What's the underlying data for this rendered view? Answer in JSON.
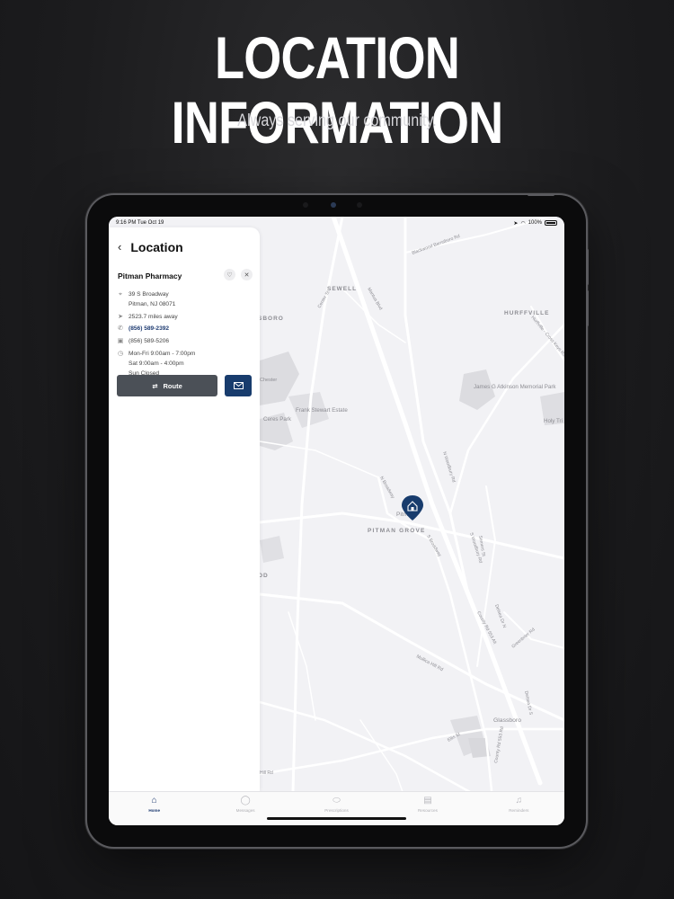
{
  "promo": {
    "headline": "LOCATION INFORMATION",
    "subheadline": "Always serving our community."
  },
  "status_bar": {
    "time": "9:16 PM  Tue Oct 19",
    "battery": "100%"
  },
  "panel": {
    "title": "Location",
    "store_name": "Pitman Pharmacy",
    "address_line1": "39 S Broadway",
    "address_line2": "Pitman, NJ 08071",
    "distance": "2523.7 miles away",
    "phone": "(856) 589-2392",
    "fax": "(856) 589-5206",
    "hours": [
      "Mon-Fri 9:00am - 7:00pm",
      "Sat 9:00am - 4:00pm",
      "Sun Closed"
    ],
    "route_label": "Route"
  },
  "map": {
    "labels": {
      "sewell": "SEWELL",
      "hurffville": "HURFFVILLE",
      "boro": "SBORO",
      "pitman_grove": "PITMAN GROVE",
      "pitman": "Pitman",
      "glassboro": "Glassboro",
      "od": "OD",
      "ceres_park": "Ceres Park",
      "frank_stewart": "Frank Stewart Estate",
      "james_atkinson": "James G Atkinson Memorial Park",
      "holy_trinity": "Holy Tri",
      "chester": "Chester",
      "blackwood": "Blackwood Barnsboro Rd",
      "n_woodbury": "N Woodbury Rd",
      "s_woodbury": "S Woodbury Rd",
      "n_broadway": "N Broadway",
      "s_broadway": "S Broadway",
      "delsea": "Delsea Dr N",
      "delsea_s": "Delsea Dr S",
      "mullica": "Mullica Hill Rd",
      "county553": "County Rd 553 Alt",
      "county553b": "County Rd 553 Rd",
      "ellis": "Ellis St",
      "center": "Center St",
      "mantua": "Mantua Blvd",
      "hurffville_cross": "Hurffville - Cross Keys Rd",
      "semers": "Semers St",
      "greentree": "Greenbrier Rd",
      "rd": "Hill Rd"
    }
  },
  "tabs": [
    {
      "label": "Home",
      "icon": "home-icon"
    },
    {
      "label": "Messages",
      "icon": "chat-icon"
    },
    {
      "label": "Prescriptions",
      "icon": "pill-icon"
    },
    {
      "label": "Resources",
      "icon": "book-icon"
    },
    {
      "label": "Reminders",
      "icon": "bell-icon"
    }
  ],
  "colors": {
    "accent": "#183c6d",
    "route_button": "#4b5057",
    "map_bg": "#f2f2f5"
  }
}
